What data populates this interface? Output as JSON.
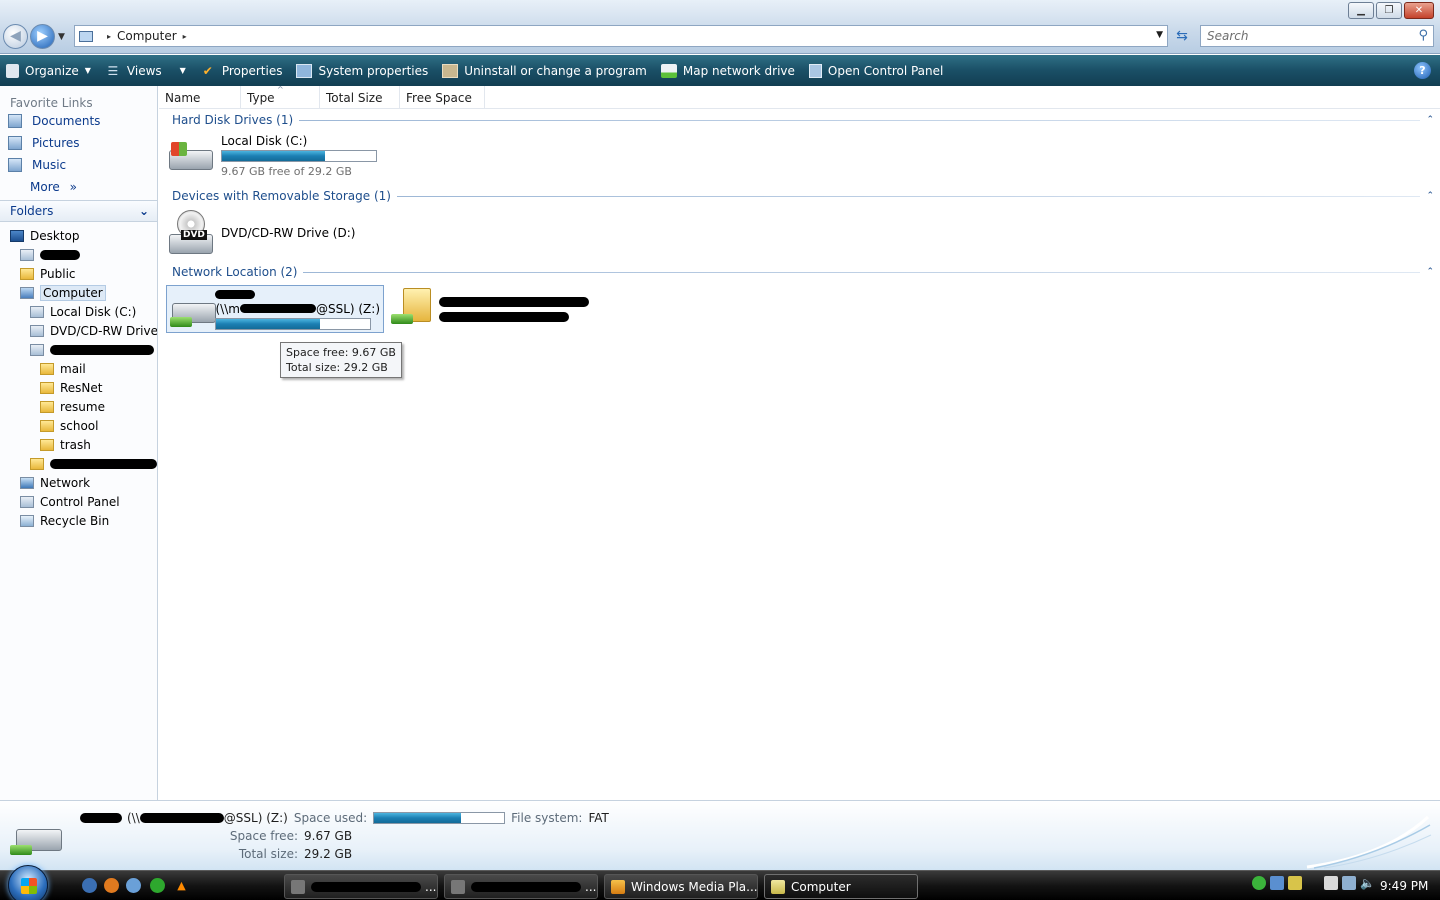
{
  "window": {
    "minimize_glyph": "▁",
    "maximize_glyph": "❐",
    "close_glyph": "✕"
  },
  "address": {
    "segment": "Computer",
    "sep": "▸",
    "drop": "▼"
  },
  "search": {
    "placeholder": "Search",
    "icon": "search-icon"
  },
  "toolbar": {
    "organize": "Organize",
    "views": "Views",
    "properties": "Properties",
    "system_properties": "System properties",
    "uninstall": "Uninstall or change a program",
    "map_drive": "Map network drive",
    "open_cp": "Open Control Panel",
    "help": "?"
  },
  "favorites": {
    "title": "Favorite Links",
    "items": [
      "Documents",
      "Pictures",
      "Music"
    ],
    "more": "More",
    "more_glyph": "»"
  },
  "folders": {
    "title": "Folders",
    "toggle": "⌄"
  },
  "tree": {
    "desktop": "Desktop",
    "public": "Public",
    "computer": "Computer",
    "local_disk": "Local Disk (C:)",
    "dvd": "DVD/CD-RW Drive (",
    "mail": "mail",
    "resnet": "ResNet",
    "resume": "resume",
    "school": "school",
    "trash": "trash",
    "network": "Network",
    "control_panel": "Control Panel",
    "recycle_bin": "Recycle Bin"
  },
  "columns": [
    "Name",
    "Type",
    "Total Size",
    "Free Space"
  ],
  "groups": {
    "hdd": "Hard Disk Drives (1)",
    "removable": "Devices with Removable Storage (1)",
    "network": "Network Location (2)",
    "collapse_glyph": "⌃"
  },
  "drives": {
    "c": {
      "name": "Local Disk (C:)",
      "sub": "9.67 GB free of 29.2 GB",
      "used_fraction": 0.67
    },
    "d": {
      "name": "DVD/CD-RW Drive (D:)",
      "disc_label": "DVD"
    },
    "z": {
      "name_prefix": "(\\\\m",
      "name_suffix": "@SSL) (Z:)",
      "used_fraction": 0.67
    }
  },
  "tooltip": {
    "line1": "Space free: 9.67 GB",
    "line2": "Total size: 29.2 GB"
  },
  "details": {
    "name_prefix": "(\\\\",
    "name_suffix": "@SSL) (Z:)",
    "space_used_label": "Space used:",
    "space_used_fraction": 0.67,
    "file_system_label": "File system:",
    "file_system": "FAT",
    "space_free_label": "Space free:",
    "space_free": "9.67 GB",
    "total_size_label": "Total size:",
    "total_size": "29.2 GB"
  },
  "taskbar": {
    "ellipsis1": "...",
    "ellipsis2": "...",
    "wmp": "Windows Media Pla...",
    "computer": "Computer",
    "clock": "9:49 PM"
  },
  "colors": {
    "toolbar": "#1a4f66",
    "link": "#0b3a8c",
    "group_label": "#1e4e8c",
    "capacity_fill": "#1c7fb3"
  }
}
